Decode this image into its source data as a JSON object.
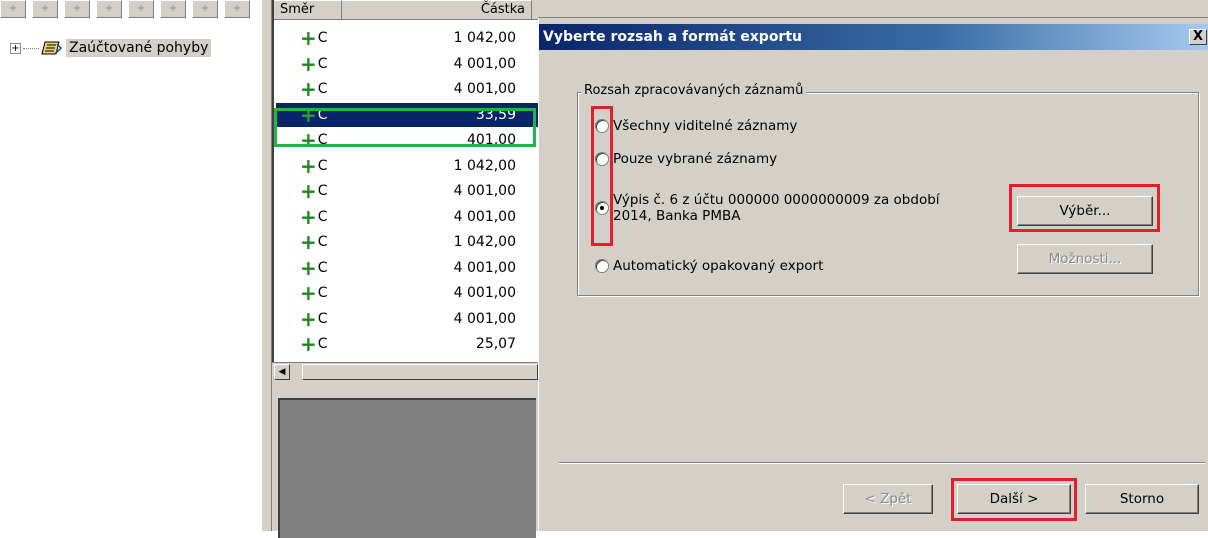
{
  "tree": {
    "toolbar_buttons": [
      "+",
      "+",
      "+",
      "+",
      "+",
      "+",
      "+",
      "+"
    ],
    "node_label": "Zaúčtované pohyby",
    "expander": "+"
  },
  "grid": {
    "columns": {
      "smer": "Směr",
      "castka": "Částka"
    },
    "rows": [
      {
        "dir": "C",
        "amount": "1 042,00"
      },
      {
        "dir": "C",
        "amount": "4 001,00"
      },
      {
        "dir": "C",
        "amount": "4 001,00"
      },
      {
        "dir": "C",
        "amount": "33,59",
        "selected": true
      },
      {
        "dir": "C",
        "amount": "401,00"
      },
      {
        "dir": "C",
        "amount": "1 042,00"
      },
      {
        "dir": "C",
        "amount": "4 001,00"
      },
      {
        "dir": "C",
        "amount": "4 001,00"
      },
      {
        "dir": "C",
        "amount": "1 042,00"
      },
      {
        "dir": "C",
        "amount": "4 001,00"
      },
      {
        "dir": "C",
        "amount": "4 001,00"
      },
      {
        "dir": "C",
        "amount": "4 001,00"
      },
      {
        "dir": "C",
        "amount": "25,07"
      }
    ]
  },
  "dialog": {
    "title": "Vyberte rozsah a formát exportu",
    "close_label": "X",
    "group_title": "Rozsah zpracovávaných záznamů",
    "options": {
      "all_visible": "Všechny viditelné záznamy",
      "selected_only": "Pouze vybrané záznamy",
      "statement_line1": "Výpis č. 6 z účtu 000000 0000000009 za období",
      "statement_line2": "2014, Banka PMBA",
      "auto_export": "Automatický opakovaný export"
    },
    "buttons": {
      "select": "Výběr...",
      "options": "Možnosti...",
      "back": "< Zpět",
      "next": "Další >",
      "cancel": "Storno"
    }
  },
  "colors": {
    "window_face": "#d4d0c8",
    "selection": "#0a246a",
    "highlight_red": "#e0202a",
    "highlight_green": "#1fb64a"
  }
}
